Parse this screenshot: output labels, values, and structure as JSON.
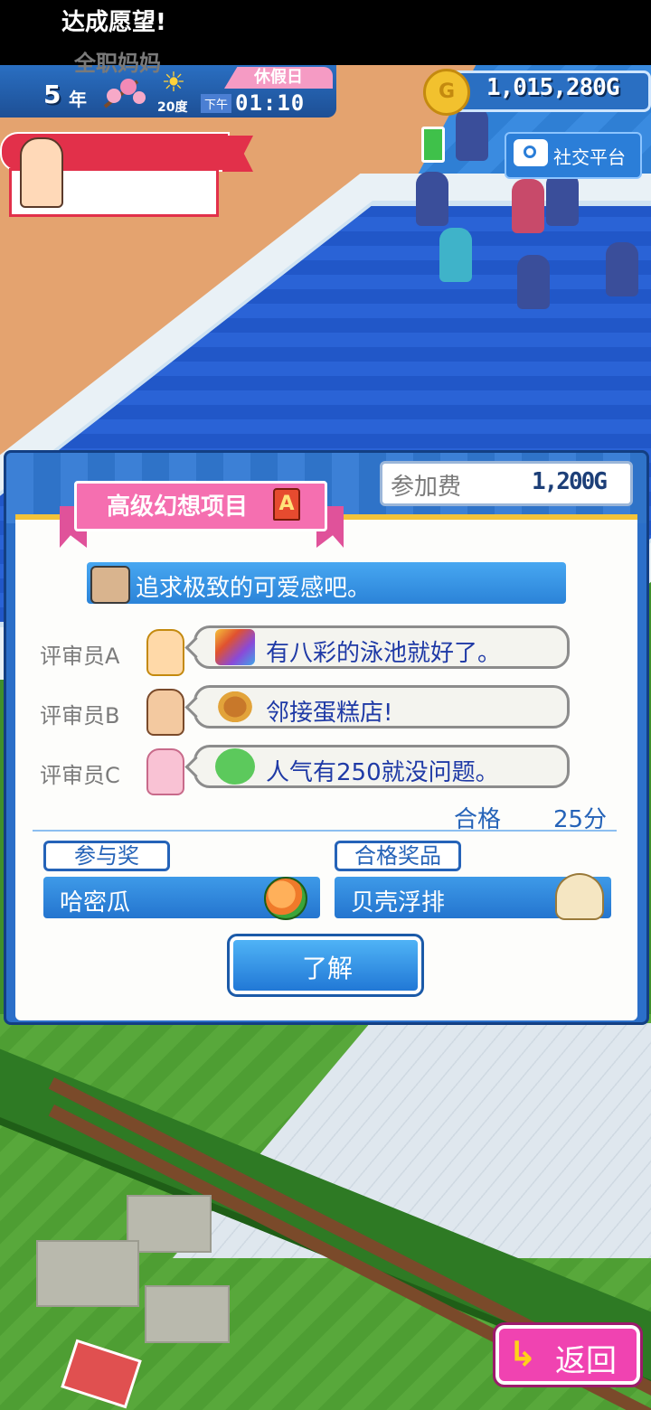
{
  "hud": {
    "year_number": "5",
    "year_suffix": "年",
    "temperature": "20度",
    "holiday": "休假日",
    "ampm": "下午",
    "time": "01:10",
    "money": "1,015,280G",
    "coin_icon": "G"
  },
  "wish": {
    "title": "达成愿望!",
    "name": "全职妈妈"
  },
  "social": {
    "label": "社交平台"
  },
  "dialog": {
    "fee_label": "参加费",
    "fee_value": "1,200G",
    "title": "高级幻想项目",
    "grade": "A",
    "goal": "追求极致的可爱感吧。",
    "judges": [
      {
        "label": "评审员A",
        "comment": "有八彩的泳池就好了。"
      },
      {
        "label": "评审员B",
        "comment": "邻接蛋糕店!"
      },
      {
        "label": "评审员C",
        "comment": "人气有250就没问题。"
      }
    ],
    "pass_label": "合格",
    "pass_score": "25分",
    "participation_prize_label": "参与奖",
    "participation_prize": "哈密瓜",
    "pass_prize_label": "合格奖品",
    "pass_prize": "贝壳浮排",
    "ok_button": "了解"
  },
  "back_button": "返回",
  "colors": {
    "dialog_blue": "#2b6fc9",
    "ribbon_pink": "#f56fb0",
    "back_pink": "#f043b1",
    "text_blue": "#1f3aa6",
    "wish_red": "#e2304a"
  }
}
